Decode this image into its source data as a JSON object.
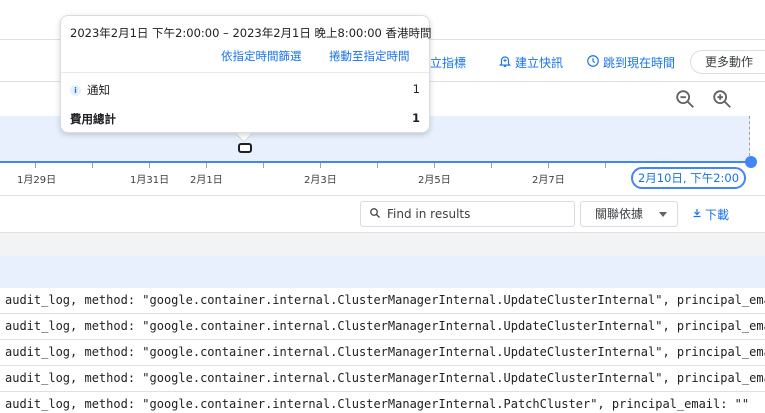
{
  "toolbar": {
    "create_metric": "建立指標",
    "create_alert": "建立快訊",
    "jump_to_now": "跳到現在時間",
    "more_actions": "更多動作"
  },
  "timeline": {
    "ticks": [
      "1月29日",
      "1月31日",
      "2月1日",
      "2月3日",
      "2月5日",
      "2月7日"
    ],
    "end_chip": "2月10日, 下午2:00"
  },
  "tooltip": {
    "range": "2023年2月1日 下午2:00:00 – 2023年2月1日 晚上8:00:00 香港時間",
    "filter_link": "依指定時間篩選",
    "scroll_link": "捲動至指定時間",
    "rows": [
      {
        "label": "通知",
        "value": "1",
        "icon": "info-icon"
      },
      {
        "label": "費用總計",
        "value": "1"
      }
    ]
  },
  "results": {
    "search_placeholder": "Find in results",
    "correlate": "關聯依據",
    "download": "下載"
  },
  "logs": [
    "audit_log, method: \"google.container.internal.ClusterManagerInternal.UpdateClusterInternal\", principal_email:",
    "audit_log, method: \"google.container.internal.ClusterManagerInternal.UpdateClusterInternal\", principal_email:",
    "audit_log, method: \"google.container.internal.ClusterManagerInternal.UpdateClusterInternal\", principal_email:",
    "audit_log, method: \"google.container.internal.ClusterManagerInternal.UpdateClusterInternal\", principal_email:",
    "audit_log, method: \"google.container.internal.ClusterManagerInternal.PatchCluster\", principal_email: \"\""
  ],
  "colors": {
    "accent": "#1a73e8",
    "timeline_bg": "#e8f0fe",
    "timeline_line": "#4285f4"
  }
}
